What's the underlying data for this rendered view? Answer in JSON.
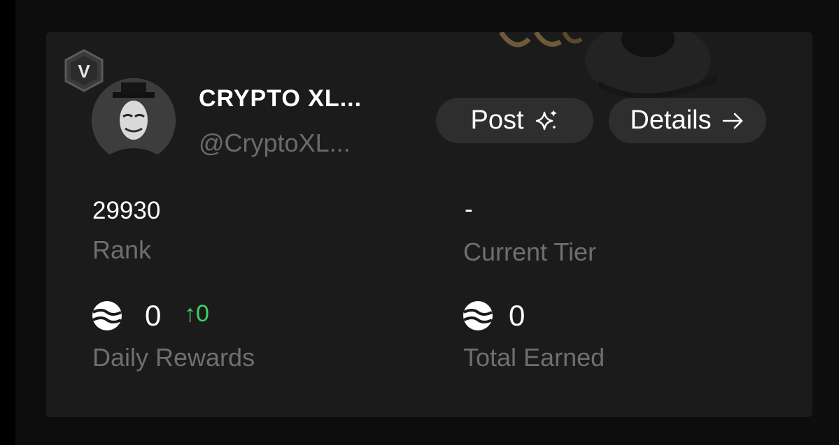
{
  "profile": {
    "badge_letter": "V",
    "display_name": "CRYPTO XL...",
    "handle": "@CryptoXL..."
  },
  "actions": {
    "post_label": "Post",
    "post_icon": "sparkles-icon",
    "details_label": "Details",
    "details_icon": "arrow-right-icon"
  },
  "stats": {
    "rank_value": "29930",
    "rank_label": "Rank",
    "tier_value": "-",
    "tier_label": "Current Tier",
    "daily_value": "0",
    "daily_delta": "↑0",
    "daily_label": "Daily Rewards",
    "total_value": "0",
    "total_label": "Total Earned",
    "token_icon": "token-coin-icon"
  },
  "colors": {
    "background": "#000000",
    "card": "#1b1b1b",
    "button": "#2e2e2e",
    "muted_text": "#6f6f6f",
    "positive": "#3fd266"
  }
}
